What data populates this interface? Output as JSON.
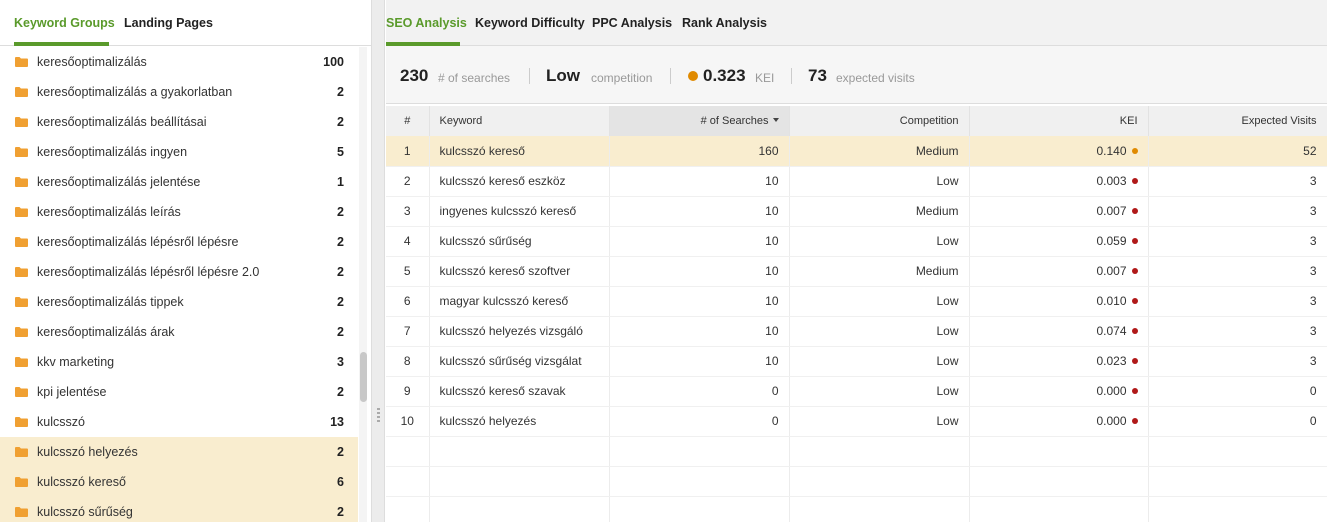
{
  "left_tabs": [
    {
      "label": "Keyword Groups",
      "active": true
    },
    {
      "label": "Landing Pages",
      "active": false
    }
  ],
  "groups": [
    {
      "name": "keresőoptimalizálás",
      "count": "100",
      "selected": false
    },
    {
      "name": "keresőoptimalizálás a gyakorlatban",
      "count": "2",
      "selected": false
    },
    {
      "name": "keresőoptimalizálás beállításai",
      "count": "2",
      "selected": false
    },
    {
      "name": "keresőoptimalizálás ingyen",
      "count": "5",
      "selected": false
    },
    {
      "name": "keresőoptimalizálás jelentése",
      "count": "1",
      "selected": false
    },
    {
      "name": "keresőoptimalizálás leírás",
      "count": "2",
      "selected": false
    },
    {
      "name": "keresőoptimalizálás lépésről lépésre",
      "count": "2",
      "selected": false
    },
    {
      "name": "keresőoptimalizálás lépésről lépésre 2.0",
      "count": "2",
      "selected": false
    },
    {
      "name": "keresőoptimalizálás tippek",
      "count": "2",
      "selected": false
    },
    {
      "name": "keresőoptimalizálás árak",
      "count": "2",
      "selected": false
    },
    {
      "name": "kkv marketing",
      "count": "3",
      "selected": false
    },
    {
      "name": "kpi jelentése",
      "count": "2",
      "selected": false
    },
    {
      "name": "kulcsszó",
      "count": "13",
      "selected": false
    },
    {
      "name": "kulcsszó helyezés",
      "count": "2",
      "selected": true
    },
    {
      "name": "kulcsszó kereső",
      "count": "6",
      "selected": true
    },
    {
      "name": "kulcsszó sűrűség",
      "count": "2",
      "selected": true
    }
  ],
  "right_tabs": [
    {
      "label": "SEO Analysis",
      "active": true
    },
    {
      "label": "Keyword Difficulty",
      "active": false
    },
    {
      "label": "PPC Analysis",
      "active": false
    },
    {
      "label": "Rank Analysis",
      "active": false
    }
  ],
  "summary": {
    "searches_value": "230",
    "searches_label": "# of searches",
    "competition_value": "Low",
    "competition_label": "competition",
    "kei_value": "0.323",
    "kei_label": "KEI",
    "visits_value": "73",
    "visits_label": "expected visits"
  },
  "colors": {
    "accent": "#5a9a2b",
    "kei_orange": "#e08a00",
    "kei_red": "#b01818",
    "selected_bg": "#f9edcf"
  },
  "table": {
    "headers": {
      "num": "#",
      "keyword": "Keyword",
      "searches": "# of Searches",
      "competition": "Competition",
      "kei": "KEI",
      "visits": "Expected Visits"
    },
    "rows": [
      {
        "num": "1",
        "keyword": "kulcsszó kereső",
        "searches": "160",
        "competition": "Medium",
        "kei": "0.140",
        "kei_color": "orange",
        "visits": "52",
        "highlight": true
      },
      {
        "num": "2",
        "keyword": "kulcsszó kereső eszköz",
        "searches": "10",
        "competition": "Low",
        "kei": "0.003",
        "kei_color": "red",
        "visits": "3"
      },
      {
        "num": "3",
        "keyword": "ingyenes kulcsszó kereső",
        "searches": "10",
        "competition": "Medium",
        "kei": "0.007",
        "kei_color": "red",
        "visits": "3"
      },
      {
        "num": "4",
        "keyword": "kulcsszó sűrűség",
        "searches": "10",
        "competition": "Low",
        "kei": "0.059",
        "kei_color": "red",
        "visits": "3"
      },
      {
        "num": "5",
        "keyword": "kulcsszó kereső szoftver",
        "searches": "10",
        "competition": "Medium",
        "kei": "0.007",
        "kei_color": "red",
        "visits": "3"
      },
      {
        "num": "6",
        "keyword": "magyar kulcsszó kereső",
        "searches": "10",
        "competition": "Low",
        "kei": "0.010",
        "kei_color": "red",
        "visits": "3"
      },
      {
        "num": "7",
        "keyword": "kulcsszó helyezés vizsgáló",
        "searches": "10",
        "competition": "Low",
        "kei": "0.074",
        "kei_color": "red",
        "visits": "3"
      },
      {
        "num": "8",
        "keyword": "kulcsszó sűrűség vizsgálat",
        "searches": "10",
        "competition": "Low",
        "kei": "0.023",
        "kei_color": "red",
        "visits": "3"
      },
      {
        "num": "9",
        "keyword": "kulcsszó kereső szavak",
        "searches": "0",
        "competition": "Low",
        "kei": "0.000",
        "kei_color": "red",
        "visits": "0"
      },
      {
        "num": "10",
        "keyword": "kulcsszó helyezés",
        "searches": "0",
        "competition": "Low",
        "kei": "0.000",
        "kei_color": "red",
        "visits": "0"
      }
    ]
  }
}
